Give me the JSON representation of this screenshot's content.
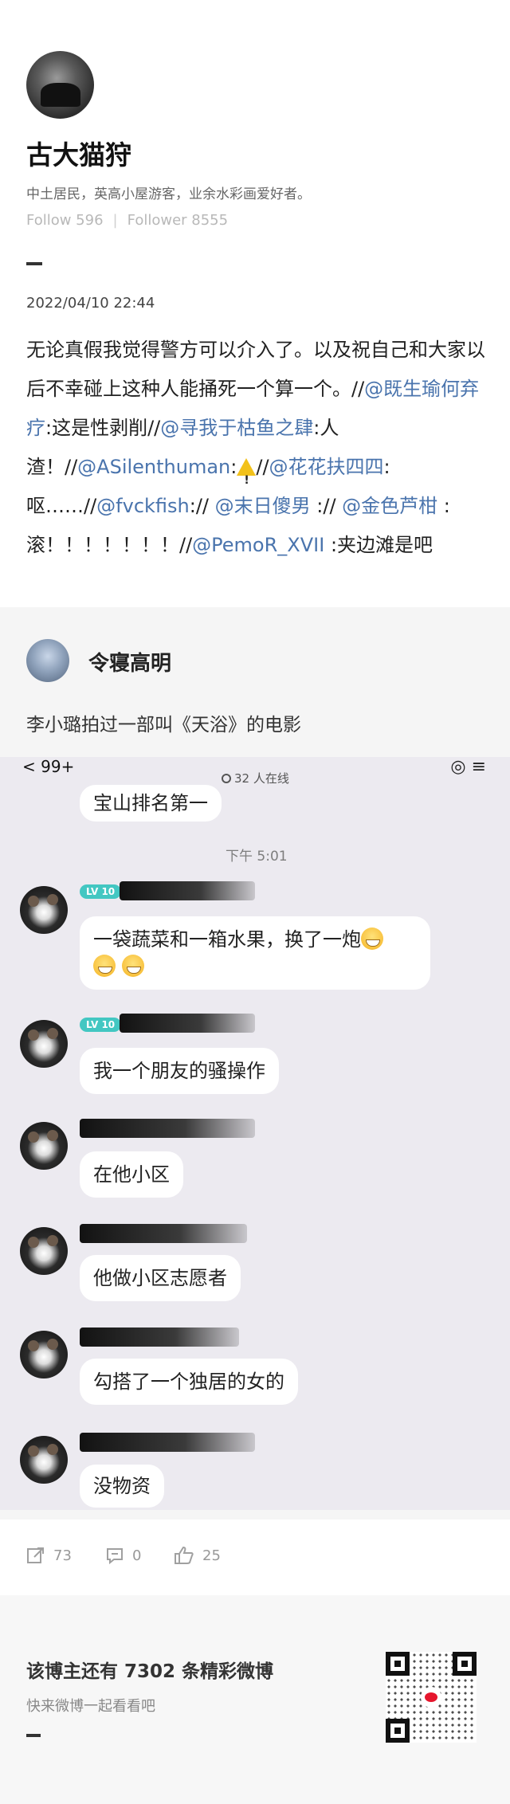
{
  "profile": {
    "username": "古大猫狩",
    "bio": "中土居民，英高小屋游客，业余水彩画爱好者。",
    "follow_label": "Follow 596",
    "follower_label": "Follower 8555",
    "follow_separator": "|",
    "date": "2022/04/10 22:44"
  },
  "post": {
    "t1": "无论真假我觉得警方可以介入了。以及祝自己和大家以后不幸碰上这种人能捅死一个算一个。//",
    "m1": "@既生瑜何弃疗",
    "t2": ":这是性剥削//",
    "m2": "@寻我于枯鱼之肆",
    "t3": ":人渣！//",
    "m3": "@ASilenthuman",
    "t4": ":",
    "t5": "//",
    "m4": "@花花扶四四",
    "t6": ":呕……//",
    "m5": "@fvckfish",
    "t7": ":// ",
    "m6": "@末日傻男",
    "t8": " :// ",
    "m7": "@金色芦柑",
    "t9": " :滚！！！！！！！//",
    "m8": "@PemoR_XVII",
    "t10": " :夹边滩是吧"
  },
  "repost": {
    "name": "令寝高明",
    "text": "李小璐拍过一部叫《天浴》的电影"
  },
  "chat": {
    "back_badge": "< 99+",
    "online_text": "32 人在线",
    "top_right": "◎ ≡",
    "first_bubble": "宝山排名第一",
    "time_label": "下午 5:01",
    "level_badge": "LV 10",
    "messages": [
      "一袋蔬菜和一箱水果，换了一炮",
      "我一个朋友的骚操作",
      "在他小区",
      "他做小区志愿者",
      "勾搭了一个独居的女的",
      "没物资"
    ]
  },
  "actions": {
    "repost_count": "73",
    "comment_count": "0",
    "like_count": "25"
  },
  "footer": {
    "title": "该博主还有 7302 条精彩微博",
    "subtitle": "快来微博一起看看吧"
  },
  "watermark": "微博",
  "colors": {
    "mention": "#4a74ad",
    "chat_bg": "#eceaf0",
    "level_badge": "#43c7c2",
    "weibo_red": "#e6162d"
  }
}
